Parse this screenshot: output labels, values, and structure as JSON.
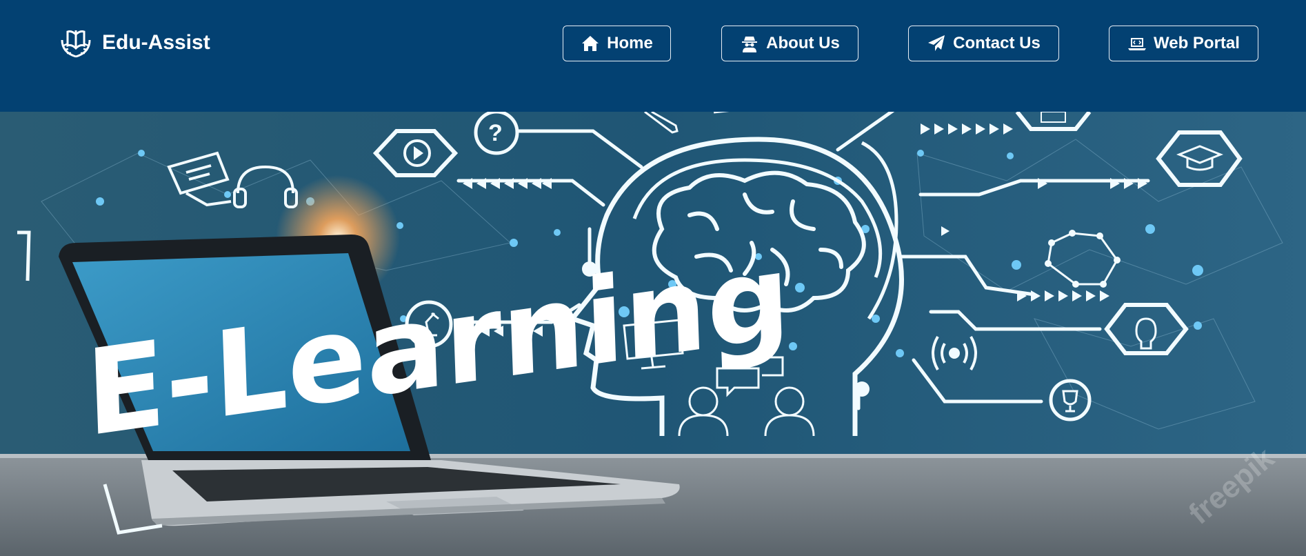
{
  "brand": {
    "name": "Edu-Assist",
    "logo_icon": "open-book-laurel-icon"
  },
  "nav": {
    "home": {
      "label": "Home",
      "icon": "home-icon"
    },
    "about": {
      "label": "About Us",
      "icon": "user-secret-icon"
    },
    "contact": {
      "label": "Contact Us",
      "icon": "paper-plane-icon"
    },
    "portal": {
      "label": "Web Portal",
      "icon": "laptop-code-icon"
    }
  },
  "hero": {
    "headline": "E-Learning",
    "watermark": "freepik"
  },
  "colors": {
    "navbar_bg": "#034172",
    "hero_bg": "#1d5a78",
    "accent": "#6ec8f5",
    "screen_blue": "#2b86b5"
  }
}
